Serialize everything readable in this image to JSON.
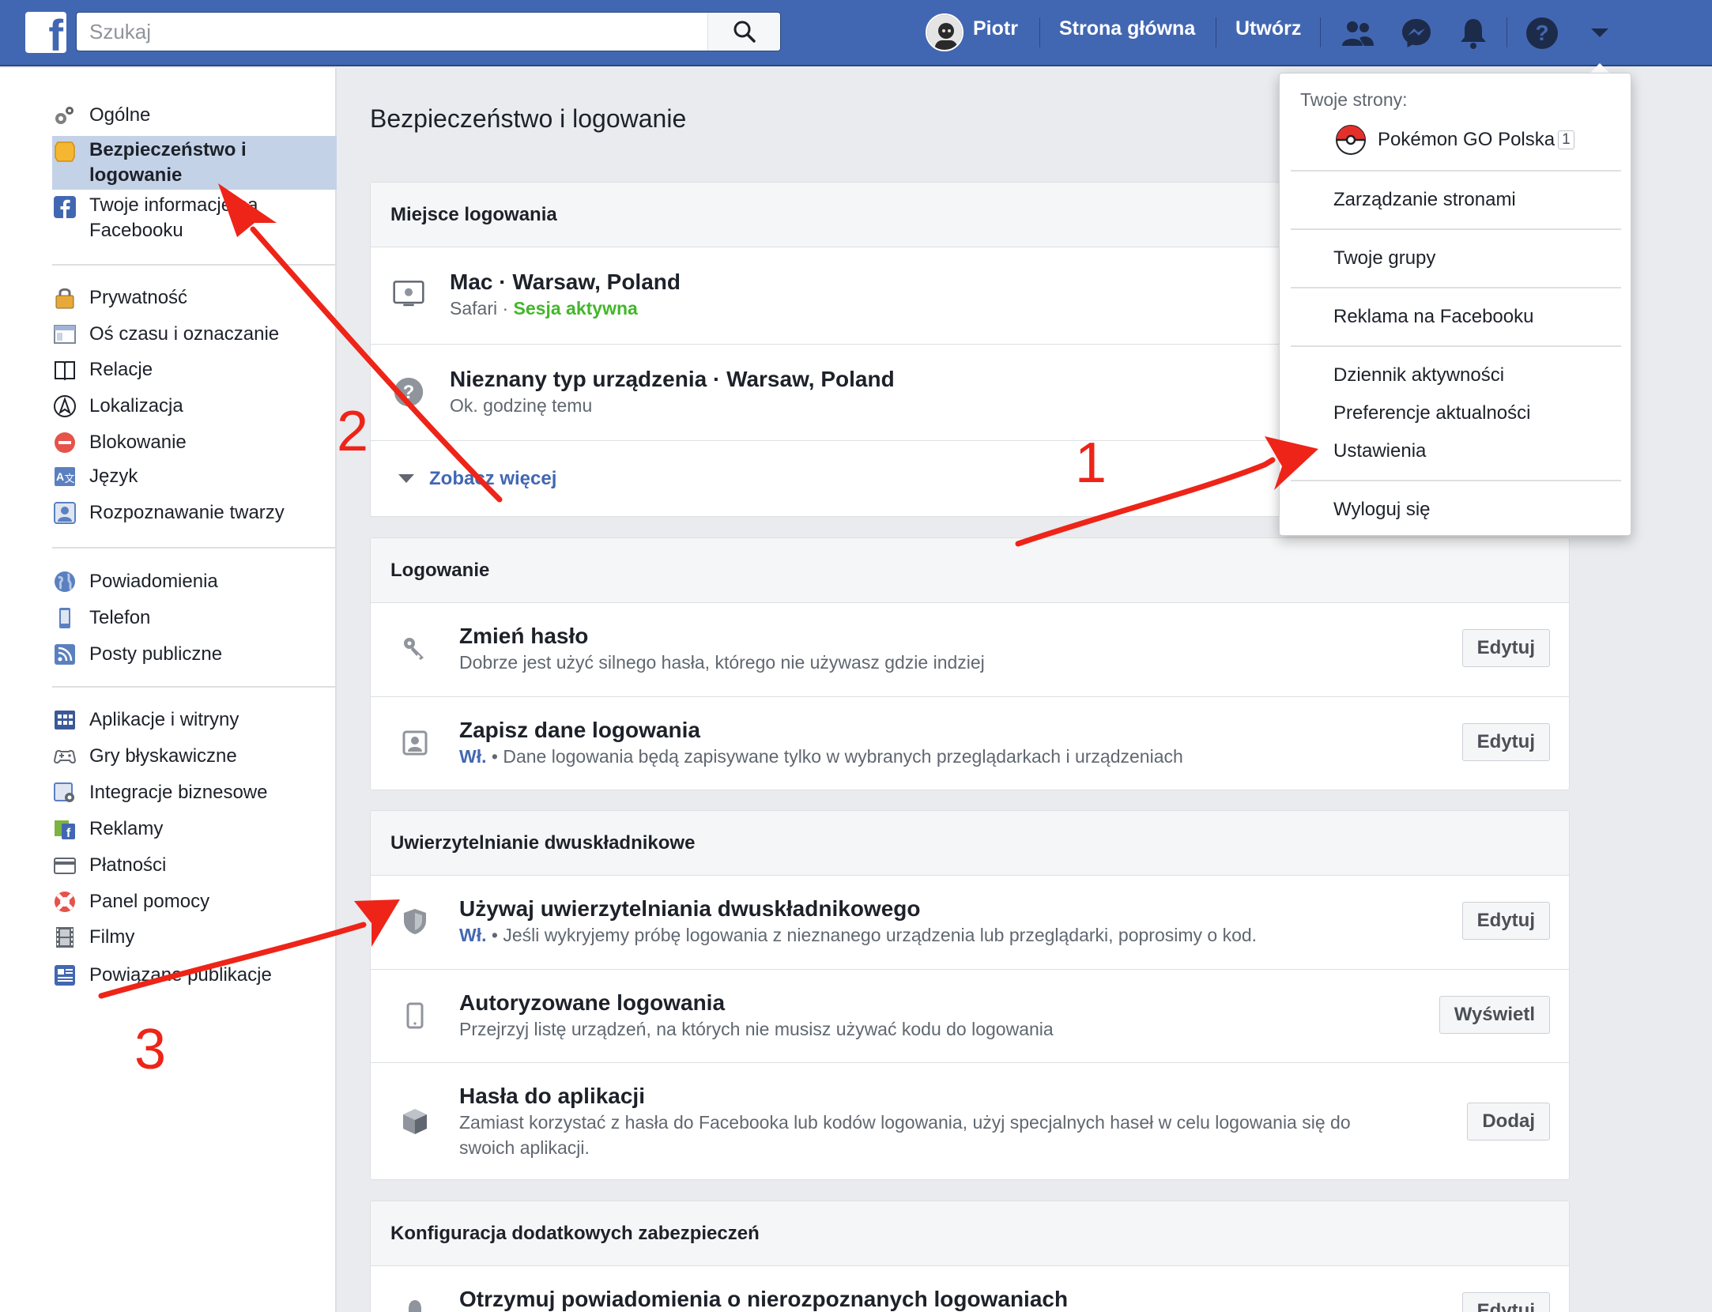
{
  "topbar": {
    "search_placeholder": "Szukaj",
    "user_name": "Piotr",
    "home_label": "Strona główna",
    "create_label": "Utwórz",
    "logo_letter": "f"
  },
  "sidebar": {
    "groups": [
      [
        {
          "label": "Ogólne",
          "icon": "gears-icon"
        },
        {
          "label": "Bezpieczeństwo i logowanie",
          "icon": "security-badge-icon",
          "active": true
        },
        {
          "label": "Twoje informacje na Facebooku",
          "icon": "facebook-square-icon"
        }
      ],
      [
        {
          "label": "Prywatność",
          "icon": "lock-icon"
        },
        {
          "label": "Oś czasu i oznaczanie",
          "icon": "timeline-icon"
        },
        {
          "label": "Relacje",
          "icon": "book-icon"
        },
        {
          "label": "Lokalizacja",
          "icon": "location-icon"
        },
        {
          "label": "Blokowanie",
          "icon": "block-icon"
        },
        {
          "label": "Język",
          "icon": "language-icon"
        },
        {
          "label": "Rozpoznawanie twarzy",
          "icon": "face-recognition-icon"
        }
      ],
      [
        {
          "label": "Powiadomienia",
          "icon": "globe-icon"
        },
        {
          "label": "Telefon",
          "icon": "phone-icon"
        },
        {
          "label": "Posty publiczne",
          "icon": "rss-icon"
        }
      ],
      [
        {
          "label": "Aplikacje i witryny",
          "icon": "apps-grid-icon"
        },
        {
          "label": "Gry błyskawiczne",
          "icon": "gamepad-icon"
        },
        {
          "label": "Integracje biznesowe",
          "icon": "business-integrations-icon"
        },
        {
          "label": "Reklamy",
          "icon": "ads-icon"
        },
        {
          "label": "Płatności",
          "icon": "credit-card-icon"
        },
        {
          "label": "Panel pomocy",
          "icon": "lifebuoy-icon"
        },
        {
          "label": "Filmy",
          "icon": "film-icon"
        },
        {
          "label": "Powiązane publikacje",
          "icon": "publications-icon"
        }
      ]
    ],
    "active_label_line1": "Bezpieczeństwo i",
    "active_label_line2": "logowanie",
    "info_label_line1": "Twoje informacje na",
    "info_label_line2": "Facebooku"
  },
  "main": {
    "title": "Bezpieczeństwo i logowanie",
    "login_location": {
      "header": "Miejsce logowania",
      "sessions": [
        {
          "title": "Mac · Warsaw, Poland",
          "browser": "Safari",
          "status": "Sesja aktywna",
          "icon": "monitor-apple-icon"
        },
        {
          "title": "Nieznany typ urządzenia · Warsaw, Poland",
          "sub": "Ok. godzinę temu",
          "icon": "unknown-device-icon"
        }
      ],
      "see_more": "Zobacz więcej"
    },
    "login": {
      "header": "Logowanie",
      "rows": [
        {
          "title": "Zmień hasło",
          "sub": "Dobrze jest użyć silnego hasła, którego nie używasz gdzie indziej",
          "button": "Edytuj",
          "icon": "key-icon"
        },
        {
          "title": "Zapisz dane logowania",
          "on": "Wł.",
          "sub": "Dane logowania będą zapisywane tylko w wybranych przeglądarkach i urządzeniach",
          "button": "Edytuj",
          "icon": "profile-card-icon"
        }
      ]
    },
    "two_factor": {
      "header": "Uwierzytelnianie dwuskładnikowe",
      "rows": [
        {
          "title": "Używaj uwierzytelniania dwuskładnikowego",
          "on": "Wł.",
          "sub": "Jeśli wykryjemy próbę logowania z nieznanego urządzenia lub przeglądarki, poprosimy o kod.",
          "button": "Edytuj",
          "icon": "shield-icon"
        },
        {
          "title": "Autoryzowane logowania",
          "sub": "Przejrzyj listę urządzeń, na których nie musisz używać kodu do logowania",
          "button": "Wyświetl",
          "icon": "mobile-icon"
        },
        {
          "title": "Hasła do aplikacji",
          "sub_line1": "Zamiast korzystać z hasła do Facebooka lub kodów logowania, użyj specjalnych haseł w celu logowania się do",
          "sub_line2": "swoich aplikacji.",
          "button": "Dodaj",
          "icon": "cube-icon"
        }
      ]
    },
    "extra_security": {
      "header": "Konfiguracja dodatkowych zabezpieczeń",
      "rows": [
        {
          "title": "Otrzymuj powiadomienia o nierozpoznanych logowaniach",
          "button": "Edytuj",
          "icon": "bell-icon"
        }
      ]
    }
  },
  "dropdown": {
    "pages_label": "Twoje strony:",
    "page_name": "Pokémon GO Polska",
    "page_badge": "1",
    "items": [
      "Zarządzanie stronami",
      "Twoje grupy",
      "Reklama na Facebooku",
      "Dziennik aktywności",
      "Preferencje aktualności",
      "Ustawienia",
      "Wyloguj się"
    ]
  },
  "annotations": {
    "numbers": [
      "1",
      "2",
      "3"
    ],
    "color": "#ee2418"
  },
  "colors": {
    "brand": "#4267b2",
    "active_bg": "#c4d2e7",
    "active_green": "#42b72a"
  }
}
